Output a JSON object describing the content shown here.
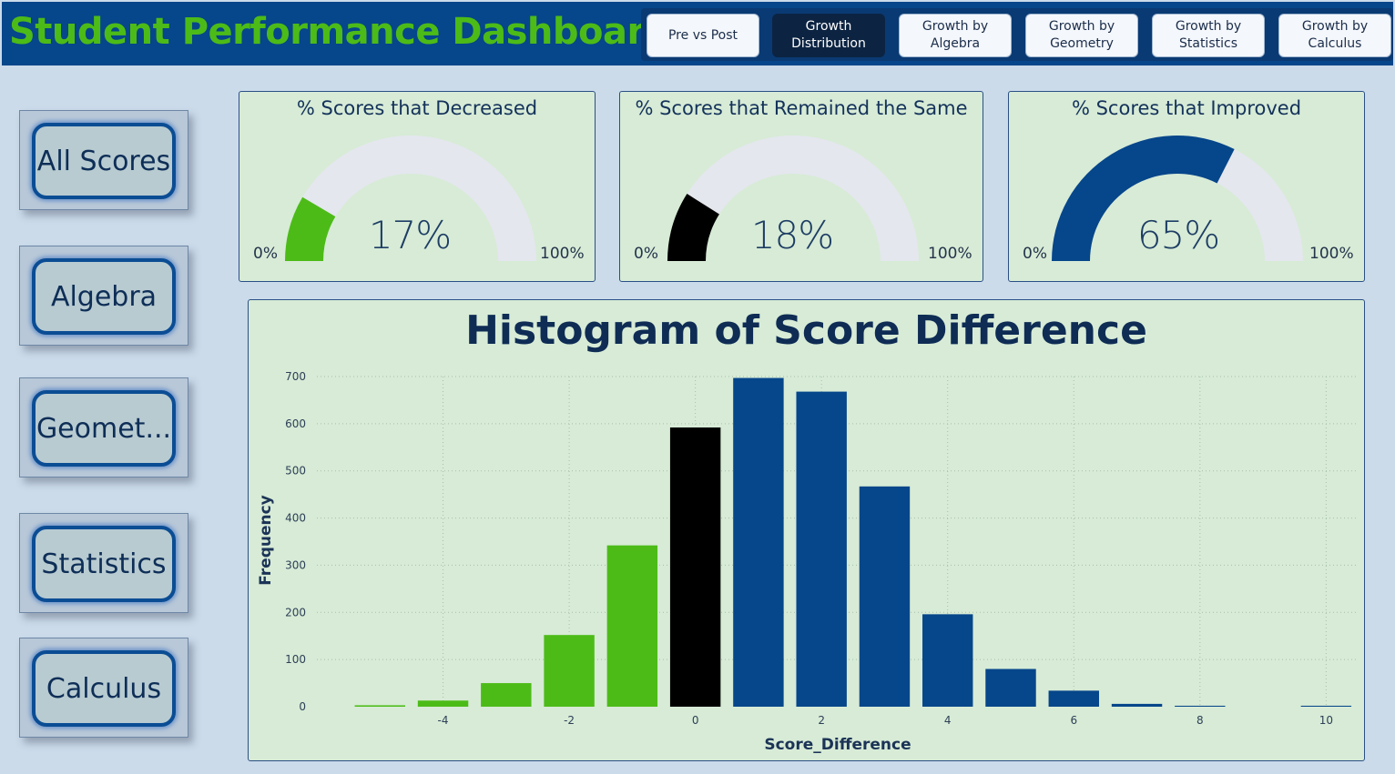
{
  "header": {
    "title": "Student Performance Dashboard",
    "title_color": "#4cbb17",
    "background": "#06468a"
  },
  "nav": {
    "buttons": [
      {
        "label": "Pre vs Post",
        "active": false
      },
      {
        "label": "Growth\nDistribution",
        "active": true
      },
      {
        "label": "Growth by\nAlgebra",
        "active": false
      },
      {
        "label": "Growth by\nGeometry",
        "active": false
      },
      {
        "label": "Growth by\nStatistics",
        "active": false
      },
      {
        "label": "Growth by\nCalculus",
        "active": false
      }
    ]
  },
  "slicers": [
    {
      "label": "All Scores"
    },
    {
      "label": "Algebra"
    },
    {
      "label": "Geomet..."
    },
    {
      "label": "Statistics"
    },
    {
      "label": "Calculus"
    }
  ],
  "gauges": [
    {
      "title": "% Scores that Decreased",
      "value_text": "17%",
      "value": 0.17,
      "min": "0%",
      "max": "100%",
      "color": "#4cbb17"
    },
    {
      "title": "% Scores that Remained the Same",
      "value_text": "18%",
      "value": 0.18,
      "min": "0%",
      "max": "100%",
      "color": "#000000"
    },
    {
      "title": "% Scores that Improved",
      "value_text": "65%",
      "value": 0.65,
      "min": "0%",
      "max": "100%",
      "color": "#06468a"
    }
  ],
  "chart_data": {
    "type": "bar",
    "title": "Histogram of Score Difference",
    "xlabel": "Score_Difference",
    "ylabel": "Frequency",
    "x": [
      -5,
      -4,
      -3,
      -2,
      -1,
      0,
      1,
      2,
      3,
      4,
      5,
      6,
      7,
      8,
      9,
      10
    ],
    "values": [
      3,
      13,
      50,
      152,
      342,
      592,
      697,
      668,
      467,
      196,
      80,
      34,
      6,
      2,
      0,
      2
    ],
    "xlim": [
      -6,
      10.5
    ],
    "ylim": [
      0,
      700
    ],
    "xticks": [
      -4,
      -2,
      0,
      2,
      4,
      6,
      8,
      10
    ],
    "yticks": [
      0,
      100,
      200,
      300,
      400,
      500,
      600,
      700
    ],
    "colors": {
      "decreased": "#4cbb17",
      "same": "#000000",
      "improved": "#06468a"
    },
    "grid": true,
    "legend": "none"
  }
}
